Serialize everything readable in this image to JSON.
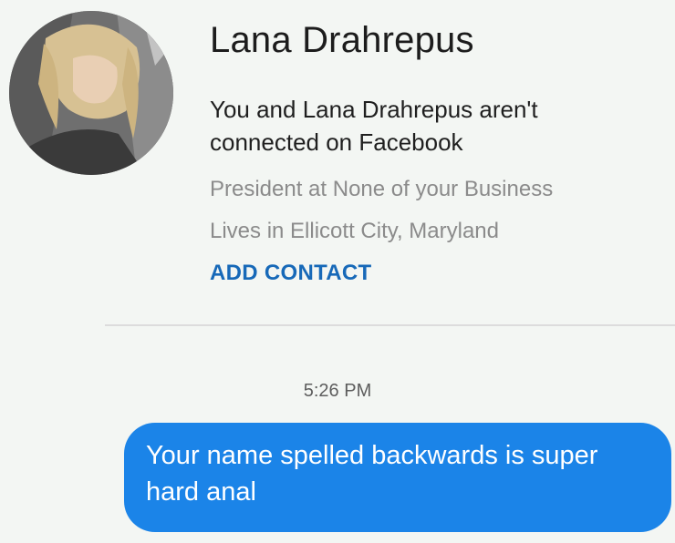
{
  "profile": {
    "name": "Lana Drahrepus",
    "connection_status": "You and Lana Drahrepus aren't connected on Facebook",
    "work": "President at None of your Business",
    "location": "Lives in Ellicott City, Maryland",
    "add_contact_label": "ADD CONTACT",
    "avatar_icon": "profile-photo"
  },
  "conversation": {
    "timestamp": "5:26 PM",
    "messages": [
      {
        "text": "Your name spelled backwards is super hard anal",
        "sender": "self",
        "bubble_color": "#1b84e8"
      }
    ]
  },
  "colors": {
    "accent": "#1769b8",
    "background": "#f3f6f3",
    "secondary_text": "#8b8b8b"
  }
}
